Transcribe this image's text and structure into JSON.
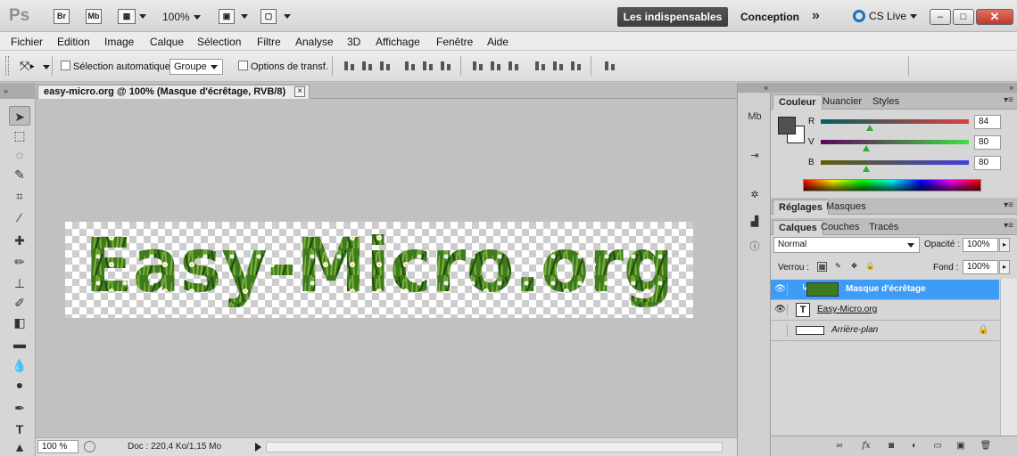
{
  "appbar": {
    "logo": "Ps",
    "bridge_label": "Br",
    "minibridge_label": "Mb",
    "zoom": "100%",
    "workspace_active": "Les indispensables",
    "workspace_other": "Conception",
    "more": "»",
    "cslive": "CS Live",
    "minimize": "–",
    "maximize": "□",
    "close": "✕"
  },
  "menu": [
    "Fichier",
    "Edition",
    "Image",
    "Calque",
    "Sélection",
    "Filtre",
    "Analyse",
    "3D",
    "Affichage",
    "Fenêtre",
    "Aide"
  ],
  "options": {
    "auto_select_label": "Sélection automatique :",
    "auto_select_value": "Groupe",
    "transform_label": "Options de transf."
  },
  "document": {
    "tab_title": "easy-micro.org @ 100% (Masque d'écrêtage, RVB/8)",
    "canvas_text": "Easy-Micro.org"
  },
  "status": {
    "zoom": "100 %",
    "doc_info": "Doc : 220,4 Ko/1,15 Mo"
  },
  "color_panel": {
    "tabs": [
      "Couleur",
      "Nuancier",
      "Styles"
    ],
    "channels": [
      {
        "label": "R",
        "value": "84",
        "fraction": 0.33,
        "color_from": "#006060",
        "color_to": "#e04040"
      },
      {
        "label": "V",
        "value": "80",
        "fraction": 0.31,
        "color_from": "#600060",
        "color_to": "#40e040"
      },
      {
        "label": "B",
        "value": "80",
        "fraction": 0.31,
        "color_from": "#606000",
        "color_to": "#4040e0"
      }
    ],
    "fg_color": "#545050",
    "bg_color": "#ffffff"
  },
  "adjust_panel": {
    "tabs": [
      "Réglages",
      "Masques"
    ]
  },
  "layers_panel": {
    "tabs": [
      "Calques",
      "Couches",
      "Tracés"
    ],
    "blend_mode": "Normal",
    "opacity_label": "Opacité :",
    "opacity": "100%",
    "lock_label": "Verrou :",
    "fill_label": "Fond :",
    "fill": "100%",
    "layers": [
      {
        "name": "Masque d'écrêtage",
        "selected": true,
        "visible": true
      },
      {
        "name": "Easy-Micro.org",
        "selected": false,
        "visible": true
      },
      {
        "name": "Arrière-plan",
        "selected": false,
        "visible": false
      }
    ]
  },
  "accent": "#3d9cf5"
}
